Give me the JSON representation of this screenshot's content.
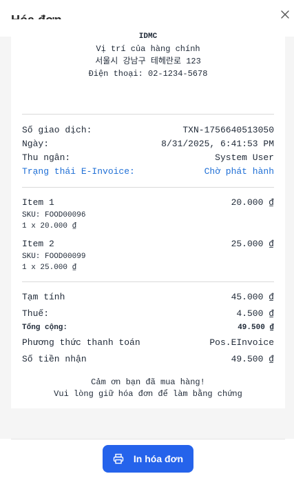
{
  "modal": {
    "title": "Hóa đơn",
    "print_label": "In hóa đơn"
  },
  "store": {
    "name": "IDMC",
    "line1": "Vị trí của hàng chính",
    "line2": "서울시 강남구 테헤란로 123",
    "line3": "Điện thoại: 02-1234-5678"
  },
  "info": {
    "txn_label": "Số giao dịch:",
    "txn_value": "TXN-1756640513050",
    "date_label": "Ngày:",
    "date_value": "8/31/2025, 6:41:53 PM",
    "cashier_label": "Thu ngân:",
    "cashier_value": "System User",
    "einvoice_label": "Trạng thái E-Invoice:",
    "einvoice_value": "Chờ phát hành"
  },
  "items": [
    {
      "name": "Item 1",
      "price": "20.000 ₫",
      "sku": "SKU: FOOD00096",
      "qty": "1 x 20.000 ₫"
    },
    {
      "name": "Item 2",
      "price": "25.000 ₫",
      "sku": "SKU: FOOD00099",
      "qty": "1 x 25.000 ₫"
    }
  ],
  "totals": {
    "subtotal_label": "Tạm tính",
    "subtotal_value": "45.000 ₫",
    "tax_label": "Thuế:",
    "tax_value": "4.500 ₫",
    "total_label": "Tổng cộng:",
    "total_value": "49.500 ₫",
    "payment_label": "Phương thức thanh toán",
    "payment_value": "Pos.EInvoice",
    "received_label": "Số tiền nhận",
    "received_value": "49.500 ₫"
  },
  "thanks": {
    "line1": "Cảm ơn bạn đã mua hàng!",
    "line2": "Vui lòng giữ hóa đơn để làm bằng chứng"
  },
  "colors": {
    "accent": "#2563eb",
    "einvoice_status": "#1f6fd6"
  },
  "icons": {
    "close": "close-icon",
    "print": "printer-icon"
  }
}
